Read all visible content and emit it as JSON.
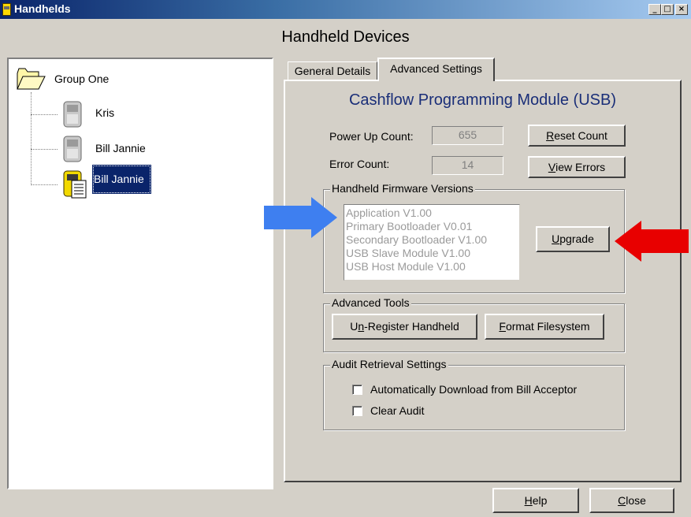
{
  "window": {
    "title": "Handhelds",
    "minimize_glyph": "_",
    "maximize_glyph": "□",
    "close_glyph": "×"
  },
  "header": {
    "title": "Handheld Devices"
  },
  "tree": {
    "root": {
      "label": "Group One",
      "icon": "folder-open-icon"
    },
    "items": [
      {
        "label": "Kris",
        "icon": "handheld-device-icon",
        "selected": false
      },
      {
        "label": "Bill Jannie",
        "icon": "handheld-device-icon",
        "selected": false
      },
      {
        "label": "Bill Jannie",
        "icon": "handheld-device-active-icon",
        "selected": true
      }
    ]
  },
  "tabs": [
    {
      "label": "General Details",
      "active": false
    },
    {
      "label": "Advanced Settings",
      "active": true
    }
  ],
  "advanced": {
    "module_title": "Cashflow Programming Module (USB)",
    "power_up_label": "Power Up Count:",
    "power_up_value": "655",
    "reset_button_mnemonic": "R",
    "reset_button_rest": "eset Count",
    "error_label": "Error Count:",
    "error_value": "14",
    "view_errors_mnemonic": "V",
    "view_errors_rest": "iew Errors",
    "firmware": {
      "group_title": "Handheld Firmware Versions",
      "versions": [
        "Application V1.00",
        "Primary Bootloader V0.01",
        "Secondary Bootloader V1.00",
        "USB Slave Module V1.00",
        "USB Host Module V1.00"
      ],
      "upgrade_mnemonic": "U",
      "upgrade_rest": "pgrade"
    },
    "tools": {
      "group_title": "Advanced Tools",
      "unregister_prefix": "U",
      "unregister_mnemonic": "n",
      "unregister_rest": "-Register Handheld",
      "format_mnemonic": "F",
      "format_rest": "ormat Filesystem"
    },
    "audit": {
      "group_title": "Audit Retrieval Settings",
      "auto_download_label": "Automatically Download from Bill Acceptor",
      "auto_download_checked": false,
      "clear_audit_label": "Clear Audit",
      "clear_audit_checked": false
    }
  },
  "footer": {
    "help_mnemonic": "H",
    "help_rest": "elp",
    "close_mnemonic": "C",
    "close_rest": "lose"
  },
  "annotations": {
    "blue_arrow_color": "#3e7ff0",
    "red_arrow_color": "#e80000"
  }
}
